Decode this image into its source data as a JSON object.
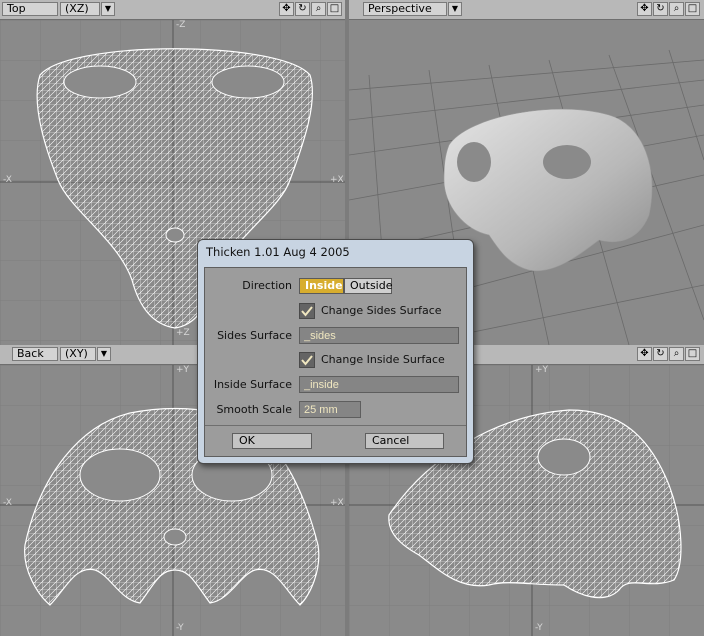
{
  "viewports": {
    "top": {
      "name": "Top",
      "mode": "(XZ)",
      "axis_left": "-X",
      "axis_right": "+X",
      "axis_top": "-Z",
      "axis_bottom": "+Z"
    },
    "perspective": {
      "name": "Perspective"
    },
    "back": {
      "name": "Back",
      "mode": "(XY)",
      "axis_left": "-X",
      "axis_right": "+X",
      "axis_top": "+Y",
      "axis_bottom": "-Y"
    },
    "side": {
      "axis_top": "+Y",
      "axis_bottom": "-Y"
    }
  },
  "icons": {
    "move": "move-icon",
    "rotate": "rotate-icon",
    "zoom": "zoom-icon",
    "menu": "dropdown-arrow-icon",
    "check": "checkmark-icon"
  },
  "dialog": {
    "title": "Thicken 1.01 Aug  4 2005",
    "direction_label": "Direction",
    "direction_options": [
      "Inside",
      "Outside"
    ],
    "direction_selected": "Inside",
    "change_sides_label": "Change Sides Surface",
    "change_sides_checked": true,
    "sides_surface_label": "Sides Surface",
    "sides_surface_value": "_sides",
    "change_inside_label": "Change Inside Surface",
    "change_inside_checked": true,
    "inside_surface_label": "Inside Surface",
    "inside_surface_value": "_inside",
    "smooth_scale_label": "Smooth Scale",
    "smooth_scale_value": "25 mm",
    "ok_label": "OK",
    "cancel_label": "Cancel"
  },
  "colors": {
    "viewport_bg": "#8a8a8a",
    "wire": "#ffffff",
    "selected_option": "#d7ad2e",
    "field_text": "#f0e7c0"
  }
}
